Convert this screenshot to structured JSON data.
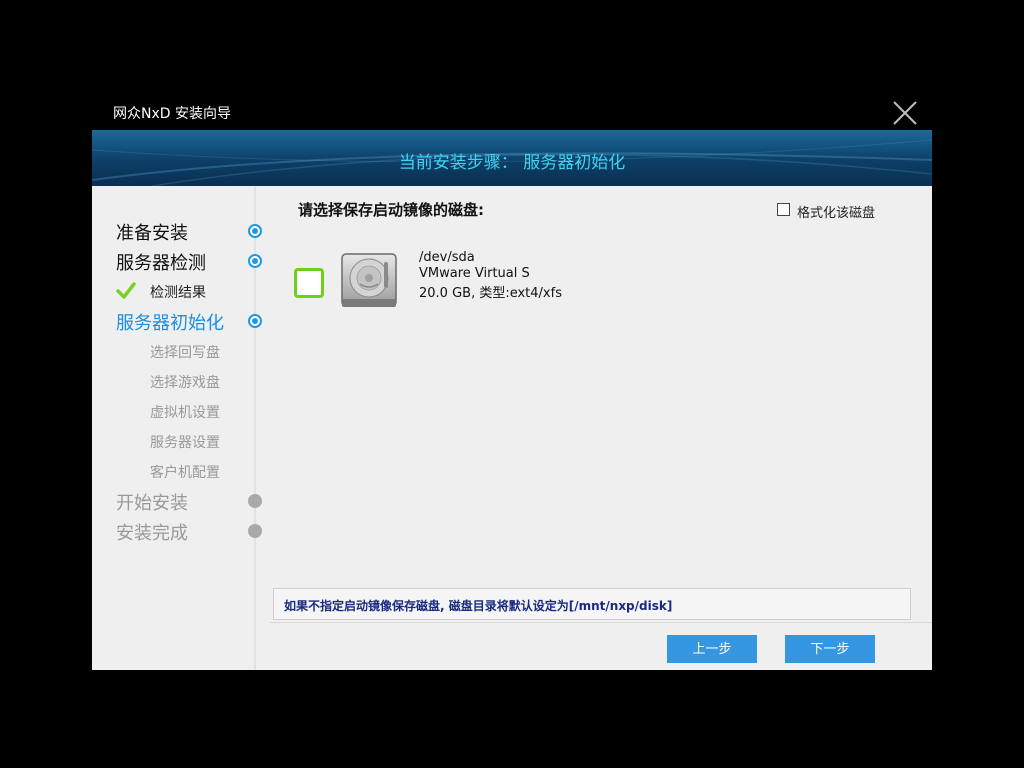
{
  "window": {
    "title": "网众NxD 安装向导"
  },
  "banner": {
    "title": "当前安装步骤： 服务器初始化"
  },
  "sidebar": {
    "steps": [
      {
        "label": "准备安装"
      },
      {
        "label": "服务器检测"
      },
      {
        "label": "检测结果"
      },
      {
        "label": "服务器初始化"
      },
      {
        "label": "选择回写盘"
      },
      {
        "label": "选择游戏盘"
      },
      {
        "label": "虚拟机设置"
      },
      {
        "label": "服务器设置"
      },
      {
        "label": "客户机配置"
      },
      {
        "label": "开始安装"
      },
      {
        "label": "安装完成"
      }
    ]
  },
  "main": {
    "prompt": "请选择保存启动镜像的磁盘:",
    "format_option": {
      "label": "格式化该磁盘",
      "checked": false
    },
    "disk": {
      "device": "/dev/sda",
      "model": "VMware Virtual S",
      "info": "20.0 GB, 类型:ext4/xfs",
      "selected": false
    },
    "hint": "如果不指定启动镜像保存磁盘, 磁盘目录将默认设定为[/mnt/nxp/disk]"
  },
  "footer": {
    "prev_label": "上一步",
    "next_label": "下一步"
  },
  "colors": {
    "accent": "#3596e2",
    "active_step": "#1a8fe0",
    "banner_text": "#3fd4f2",
    "checkbox_green": "#6fcf1c"
  }
}
